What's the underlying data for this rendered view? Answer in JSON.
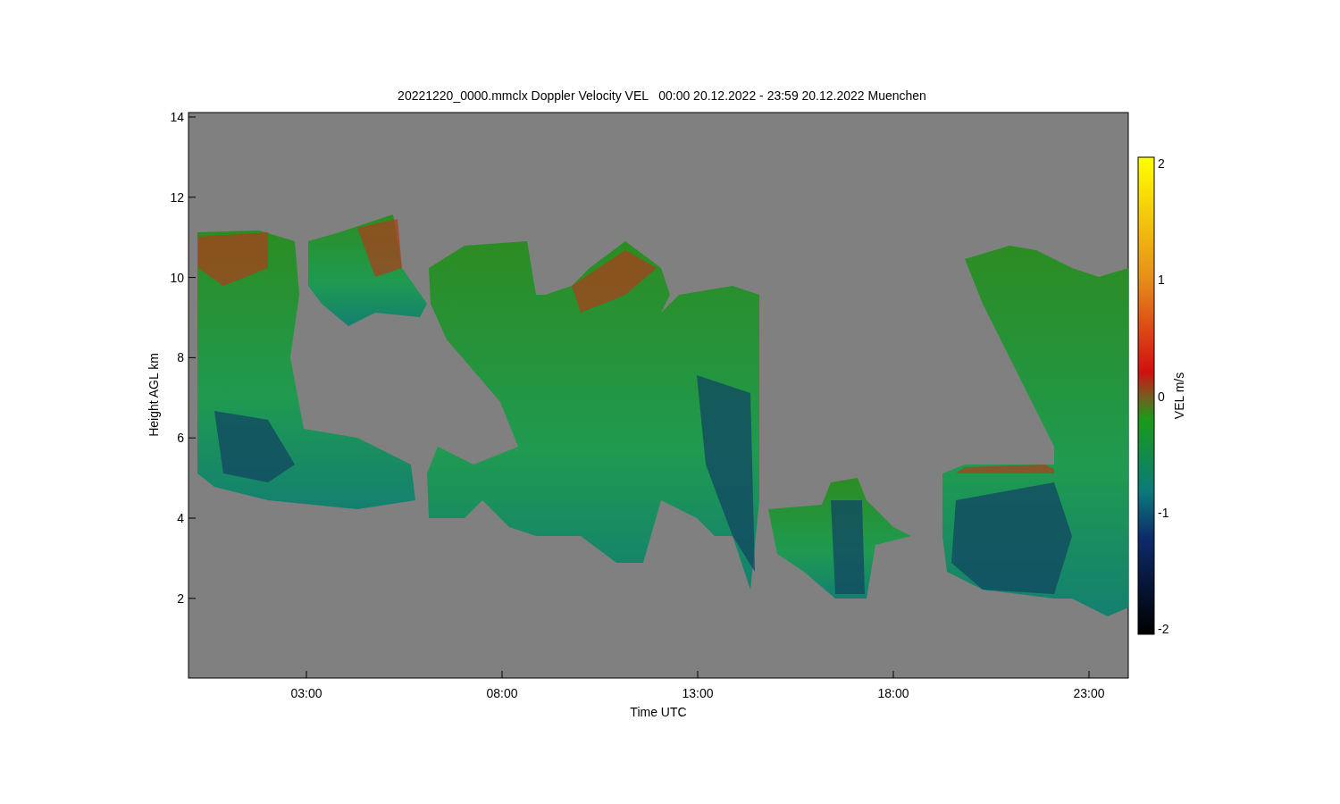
{
  "title": "20221220_0000.mmclx Doppler Velocity VEL   00:00 20.12.2022 - 23:59 20.12.2022 Muenchen",
  "plot": {
    "ylabel": "Height AGL km",
    "xlabel": "Time UTC",
    "yticks": [
      "14",
      "12",
      "10",
      "8",
      "6",
      "4",
      "2"
    ],
    "xticks": [
      "03:00",
      "08:00",
      "13:00",
      "18:00",
      "23:00"
    ]
  },
  "colorbar": {
    "label": "VEL m/s",
    "ticks": [
      "2",
      "1",
      "0",
      "-1",
      "-2"
    ]
  }
}
